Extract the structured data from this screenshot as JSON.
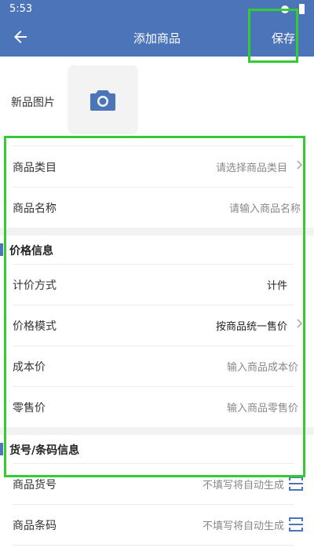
{
  "status": {
    "time": "5:53"
  },
  "appbar": {
    "title": "添加商品",
    "save_label": "保存"
  },
  "photo": {
    "label": "新品图片"
  },
  "fields": {
    "category": {
      "label": "商品类目",
      "placeholder": "请选择商品类目"
    },
    "name": {
      "label": "商品名称",
      "placeholder": "请输入商品名称"
    }
  },
  "price_section": {
    "title": "价格信息",
    "pricing_method": {
      "label": "计价方式",
      "value": "计件"
    },
    "price_mode": {
      "label": "价格模式",
      "value": "按商品统一售价"
    },
    "cost_price": {
      "label": "成本价",
      "placeholder": "输入商品成本价"
    },
    "retail_price": {
      "label": "零售价",
      "placeholder": "输入商品零售价"
    }
  },
  "code_section": {
    "title": "货号/条码信息",
    "item_no": {
      "label": "商品货号",
      "placeholder": "不填写将自动生成"
    },
    "barcode": {
      "label": "商品条码",
      "placeholder": "不填写将自动生成"
    }
  },
  "colors": {
    "primary": "#4c74b9",
    "highlight": "#33cc33"
  }
}
